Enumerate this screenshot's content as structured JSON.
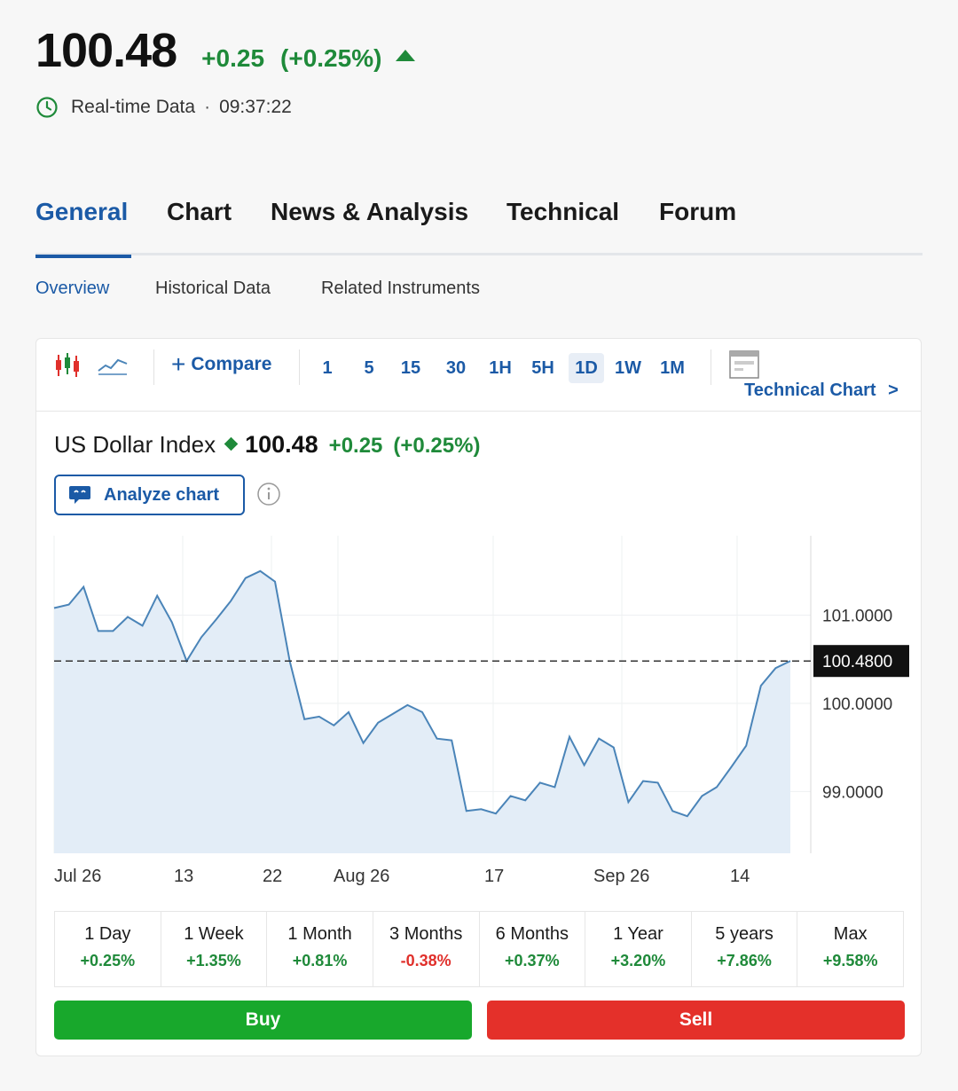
{
  "header": {
    "price": "100.48",
    "change": "+0.25",
    "change_pct": "(+0.25%)",
    "status_label": "Real-time Data",
    "separator": "·",
    "time": "09:37:22"
  },
  "main_tabs": [
    {
      "label": "General",
      "active": true
    },
    {
      "label": "Chart",
      "active": false
    },
    {
      "label": "News & Analysis",
      "active": false
    },
    {
      "label": "Technical",
      "active": false
    },
    {
      "label": "Forum",
      "active": false
    }
  ],
  "sub_tabs": [
    {
      "label": "Overview",
      "active": true
    },
    {
      "label": "Historical Data",
      "active": false
    },
    {
      "label": "Related Instruments",
      "active": false
    }
  ],
  "toolbar": {
    "compare_label": "Compare",
    "timeframes": [
      "1",
      "5",
      "15",
      "30",
      "1H",
      "5H",
      "1D",
      "1W",
      "1M"
    ],
    "active_timeframe": "1D",
    "technical_chart_label": "Technical Chart",
    "technical_chart_chevron": ">"
  },
  "chart_header": {
    "name": "US Dollar Index",
    "price": "100.48",
    "change": "+0.25",
    "change_pct": "(+0.25%)",
    "analyze_label": "Analyze chart"
  },
  "colors": {
    "accent": "#1b5aa6",
    "positive": "#1f8a3a",
    "negative": "#e0302b",
    "buy": "#18a82c",
    "sell": "#e4302a",
    "line": "#4a84b8",
    "area": "#e3edf7"
  },
  "chart_data": {
    "type": "area",
    "x_tick_labels": [
      "Jul 26",
      "13",
      "22",
      "Aug 26",
      "17",
      "Sep 26",
      "14"
    ],
    "y_tick_labels": [
      "101.0000",
      "100.0000",
      "99.0000"
    ],
    "y_ticks": [
      101,
      100,
      99
    ],
    "ylim": [
      98.3,
      101.9
    ],
    "current_value": 100.48,
    "current_label": "100.4800",
    "values": [
      101.08,
      101.12,
      101.32,
      100.82,
      100.82,
      100.98,
      100.88,
      101.22,
      100.92,
      100.48,
      100.75,
      100.95,
      101.16,
      101.42,
      101.5,
      101.38,
      100.48,
      99.82,
      99.85,
      99.75,
      99.9,
      99.55,
      99.78,
      99.88,
      99.98,
      99.9,
      99.6,
      99.58,
      98.78,
      98.8,
      98.75,
      98.95,
      98.9,
      99.1,
      99.05,
      99.62,
      99.3,
      99.6,
      99.5,
      98.88,
      99.12,
      99.1,
      98.78,
      98.72,
      98.95,
      99.05,
      99.28,
      99.52,
      100.2,
      100.4,
      100.48
    ],
    "grid": true,
    "reference_line": "dashed"
  },
  "periods": [
    {
      "label": "1 Day",
      "value": "+0.25%",
      "positive": true
    },
    {
      "label": "1 Week",
      "value": "+1.35%",
      "positive": true
    },
    {
      "label": "1 Month",
      "value": "+0.81%",
      "positive": true
    },
    {
      "label": "3 Months",
      "value": "-0.38%",
      "positive": false
    },
    {
      "label": "6 Months",
      "value": "+0.37%",
      "positive": true
    },
    {
      "label": "1 Year",
      "value": "+3.20%",
      "positive": true
    },
    {
      "label": "5 years",
      "value": "+7.86%",
      "positive": true
    },
    {
      "label": "Max",
      "value": "+9.58%",
      "positive": true
    }
  ],
  "actions": {
    "buy_label": "Buy",
    "sell_label": "Sell"
  }
}
